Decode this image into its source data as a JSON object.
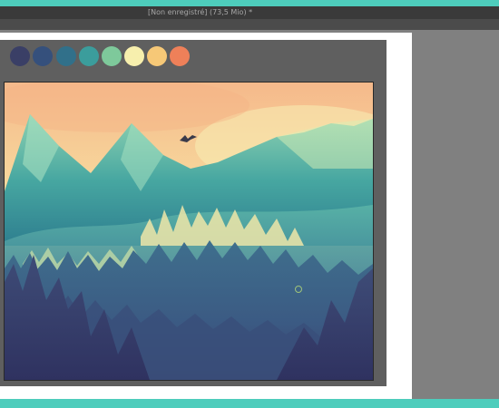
{
  "app": {
    "title": "[Non enregistré] (73,5 Mio) *"
  },
  "theme": {
    "accent": "#4ecdbc",
    "workspace": "#808080"
  },
  "palette": {
    "swatches": [
      {
        "color": "#3a3f66"
      },
      {
        "color": "#35507c"
      },
      {
        "color": "#31708a"
      },
      {
        "color": "#3b9d9c"
      },
      {
        "color": "#7ec99b"
      },
      {
        "color": "#f7efad"
      },
      {
        "color": "#f6c877"
      },
      {
        "color": "#ee8059"
      }
    ]
  },
  "canvas": {
    "image": "digital painting of mountains and a pine forest under a warm sky with a flying bird"
  }
}
